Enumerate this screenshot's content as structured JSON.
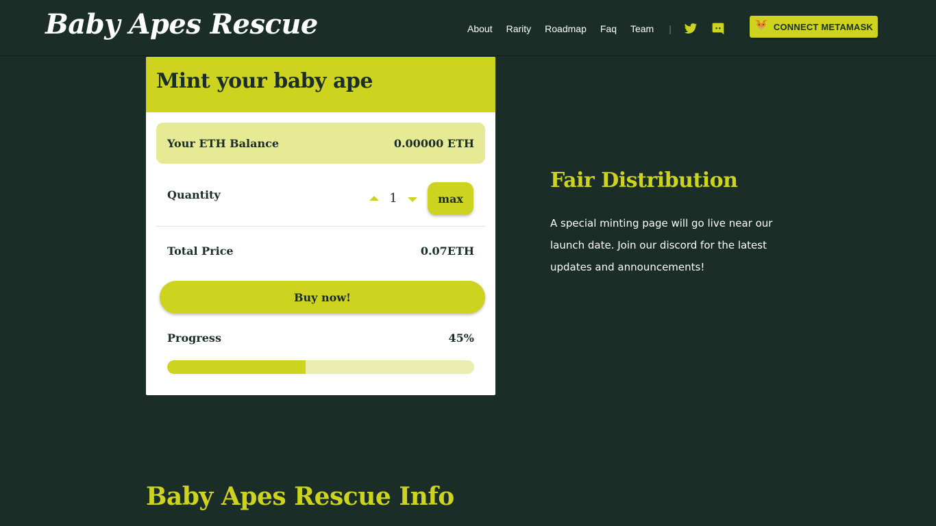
{
  "header": {
    "logo": "Baby Apes Rescue",
    "nav": [
      "About",
      "Rarity",
      "Roadmap",
      "Faq",
      "Team"
    ],
    "separator": "|",
    "social_icons": [
      "twitter-icon",
      "discord-icon"
    ],
    "connect_label": "CONNECT METAMASK",
    "connect_icon": "metamask-fox-icon"
  },
  "mint": {
    "title": "Mint your baby ape",
    "balance_label": "Your ETH Balance",
    "balance_value": "0.00000 ETH",
    "quantity_label": "Quantity",
    "quantity_value": "1",
    "max_label": "max",
    "total_label": "Total Price",
    "total_value": "0.07ETH",
    "buy_label": "Buy now!",
    "progress_label": "Progress",
    "progress_value": "45%",
    "progress_fraction": 0.45
  },
  "fair": {
    "title": "Fair Distribution",
    "text": "A special minting page will go live near our launch date. Join our discord for the latest updates and announcements!"
  },
  "info": {
    "title": "Baby Apes Rescue Info"
  },
  "colors": {
    "background": "#1a2e27",
    "accent": "#cdd31f",
    "accent_light": "#e6ea94",
    "track": "#eaedb0"
  }
}
